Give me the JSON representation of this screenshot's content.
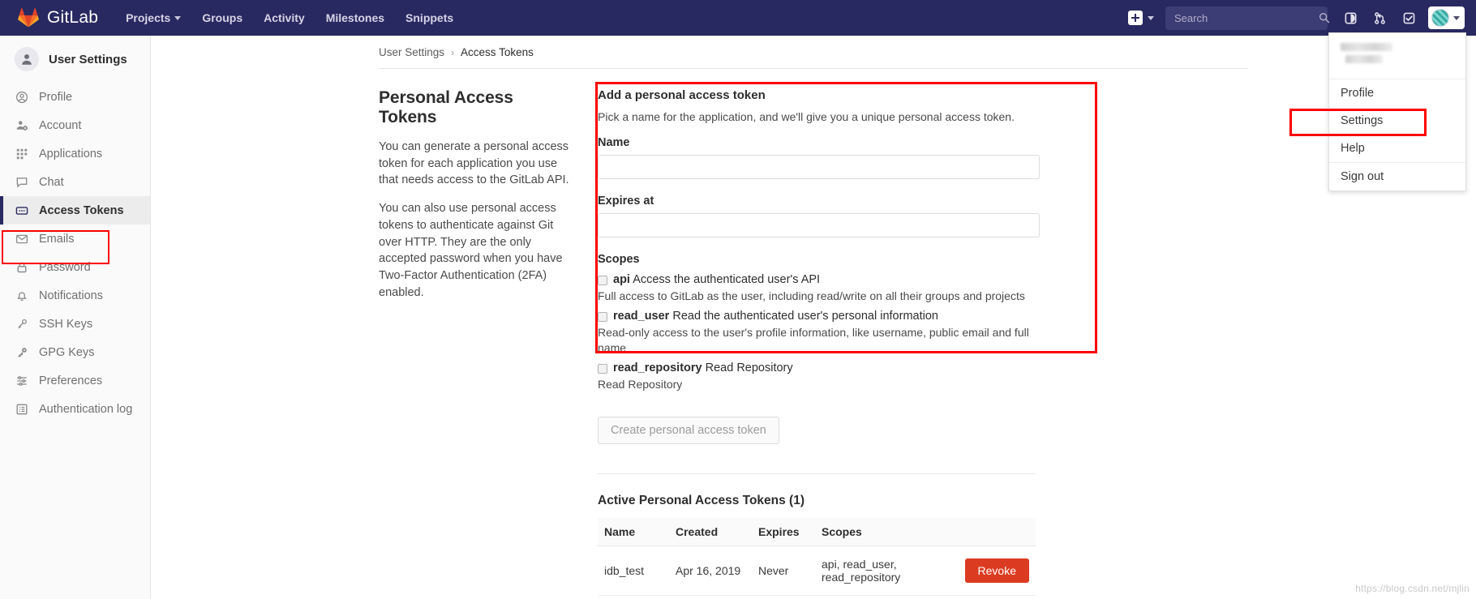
{
  "navbar": {
    "brand": "GitLab",
    "links": [
      {
        "label": "Projects",
        "has_caret": true
      },
      {
        "label": "Groups",
        "has_caret": false
      },
      {
        "label": "Activity",
        "has_caret": false
      },
      {
        "label": "Milestones",
        "has_caret": false
      },
      {
        "label": "Snippets",
        "has_caret": false
      }
    ],
    "search_placeholder": "Search",
    "search_value": "",
    "icons": [
      "plus-icon",
      "chevron-down-icon",
      "search-icon",
      "issues-icon",
      "merge-requests-icon",
      "todos-icon",
      "avatar",
      "chevron-down-icon"
    ],
    "background": "#292961"
  },
  "user_dropdown": {
    "username_redacted": "",
    "items": [
      {
        "label": "Profile",
        "highlighted": false
      },
      {
        "label": "Settings",
        "highlighted": true
      },
      {
        "label": "Help",
        "highlighted": false
      },
      {
        "label": "Sign out",
        "highlighted": false
      }
    ],
    "highlight_color": "#fe0000"
  },
  "sidebar": {
    "title": "User Settings",
    "items": [
      {
        "label": "Profile",
        "icon": "user-circle-icon",
        "active": false
      },
      {
        "label": "Account",
        "icon": "account-gear-icon",
        "active": false
      },
      {
        "label": "Applications",
        "icon": "grid-apps-icon",
        "active": false
      },
      {
        "label": "Chat",
        "icon": "chat-bubble-icon",
        "active": false
      },
      {
        "label": "Access Tokens",
        "icon": "token-card-icon",
        "active": true
      },
      {
        "label": "Emails",
        "icon": "envelope-icon",
        "active": false
      },
      {
        "label": "Password",
        "icon": "lock-icon",
        "active": false
      },
      {
        "label": "Notifications",
        "icon": "bell-icon",
        "active": false
      },
      {
        "label": "SSH Keys",
        "icon": "key-icon",
        "active": false
      },
      {
        "label": "GPG Keys",
        "icon": "gpg-key-icon",
        "active": false
      },
      {
        "label": "Preferences",
        "icon": "sliders-icon",
        "active": false
      },
      {
        "label": "Authentication log",
        "icon": "log-list-icon",
        "active": false
      }
    ],
    "highlight_color": "#fe0000"
  },
  "breadcrumb": {
    "parent": "User Settings",
    "separator": "›",
    "current": "Access Tokens"
  },
  "page": {
    "heading": "Personal Access Tokens",
    "paragraph_1": "You can generate a personal access token for each application you use that needs access to the GitLab API.",
    "paragraph_2": "You can also use personal access tokens to authenticate against Git over HTTP. They are the only accepted password when you have Two-Factor Authentication (2FA) enabled."
  },
  "form": {
    "title": "Add a personal access token",
    "subtitle": "Pick a name for the application, and we'll give you a unique personal access token.",
    "name_label": "Name",
    "name_value": "",
    "expires_label": "Expires at",
    "expires_value": "",
    "scopes_label": "Scopes",
    "scopes": [
      {
        "name": "api",
        "inline": "Access the authenticated user's API",
        "description": "Full access to GitLab as the user, including read/write on all their groups and projects",
        "checked": false
      },
      {
        "name": "read_user",
        "inline": "Read the authenticated user's personal information",
        "description": "Read-only access to the user's profile information, like username, public email and full name",
        "checked": false
      },
      {
        "name": "read_repository",
        "inline": "Read Repository",
        "description": "Read Repository",
        "checked": false
      }
    ],
    "submit_label": "Create personal access token",
    "highlight_color": "#fe0000"
  },
  "active_tokens": {
    "title": "Active Personal Access Tokens (1)",
    "columns": [
      "Name",
      "Created",
      "Expires",
      "Scopes",
      ""
    ],
    "rows": [
      {
        "name": "idb_test",
        "created": "Apr 16, 2019",
        "expires": "Never",
        "scopes": "api, read_user, read_repository",
        "action_label": "Revoke",
        "action_color": "#db3b21"
      }
    ]
  },
  "watermark": "https://blog.csdn.net/mjlin"
}
